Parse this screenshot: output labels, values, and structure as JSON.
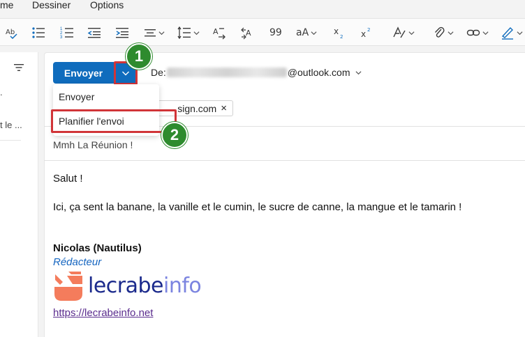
{
  "menu": {
    "tab_partial": "me",
    "tab_draw": "Dessiner",
    "tab_options": "Options"
  },
  "ribbon": {
    "icons": [
      "spelling-icon",
      "bullets-icon",
      "numbering-icon",
      "decrease-indent-icon",
      "increase-indent-icon",
      "align-icon",
      "line-spacing-icon",
      "text-direction-icon",
      "paragraph-ltr-icon",
      "quote-icon",
      "font-size-icon",
      "subscript-icon",
      "superscript-icon",
      "styles-icon",
      "attach-icon",
      "link-icon",
      "signature-icon"
    ],
    "quote_glyph": "99",
    "font_size_glyph": "aA"
  },
  "left_panel": {
    "frag1": ".",
    "frag2": "t le ..."
  },
  "compose": {
    "send_label": "Envoyer",
    "from_prefix": "De:",
    "from_domain": "@outlook.com",
    "dropdown": {
      "items": [
        "Envoyer",
        "Planifier l'envoi"
      ]
    },
    "recipient_chip": "sign.com",
    "recipient_remove": "×",
    "subject": "Mmh La Réunion !",
    "body": {
      "greeting": "Salut !",
      "paragraph": "Ici, ça sent la banane, la vanille et le cumin, le sucre de canne, la mangue et le tamarin !"
    },
    "signature": {
      "name": "Nicolas (Nautilus)",
      "role": "Rédacteur",
      "logo_part1": "lecrabe",
      "logo_part2": "info",
      "url": "https://lecrabeinfo.net"
    }
  },
  "annotations": {
    "step1": "1",
    "step2": "2",
    "highlight_color": "#d13438",
    "badge_color": "#2e8b2e"
  },
  "colors": {
    "accent": "#0f6cbd",
    "link": "#5b2d8e",
    "role": "#1565c0",
    "logo_dark": "#1b2a8c",
    "logo_light": "#7b84e0",
    "logo_mark": "#f47c5c"
  }
}
